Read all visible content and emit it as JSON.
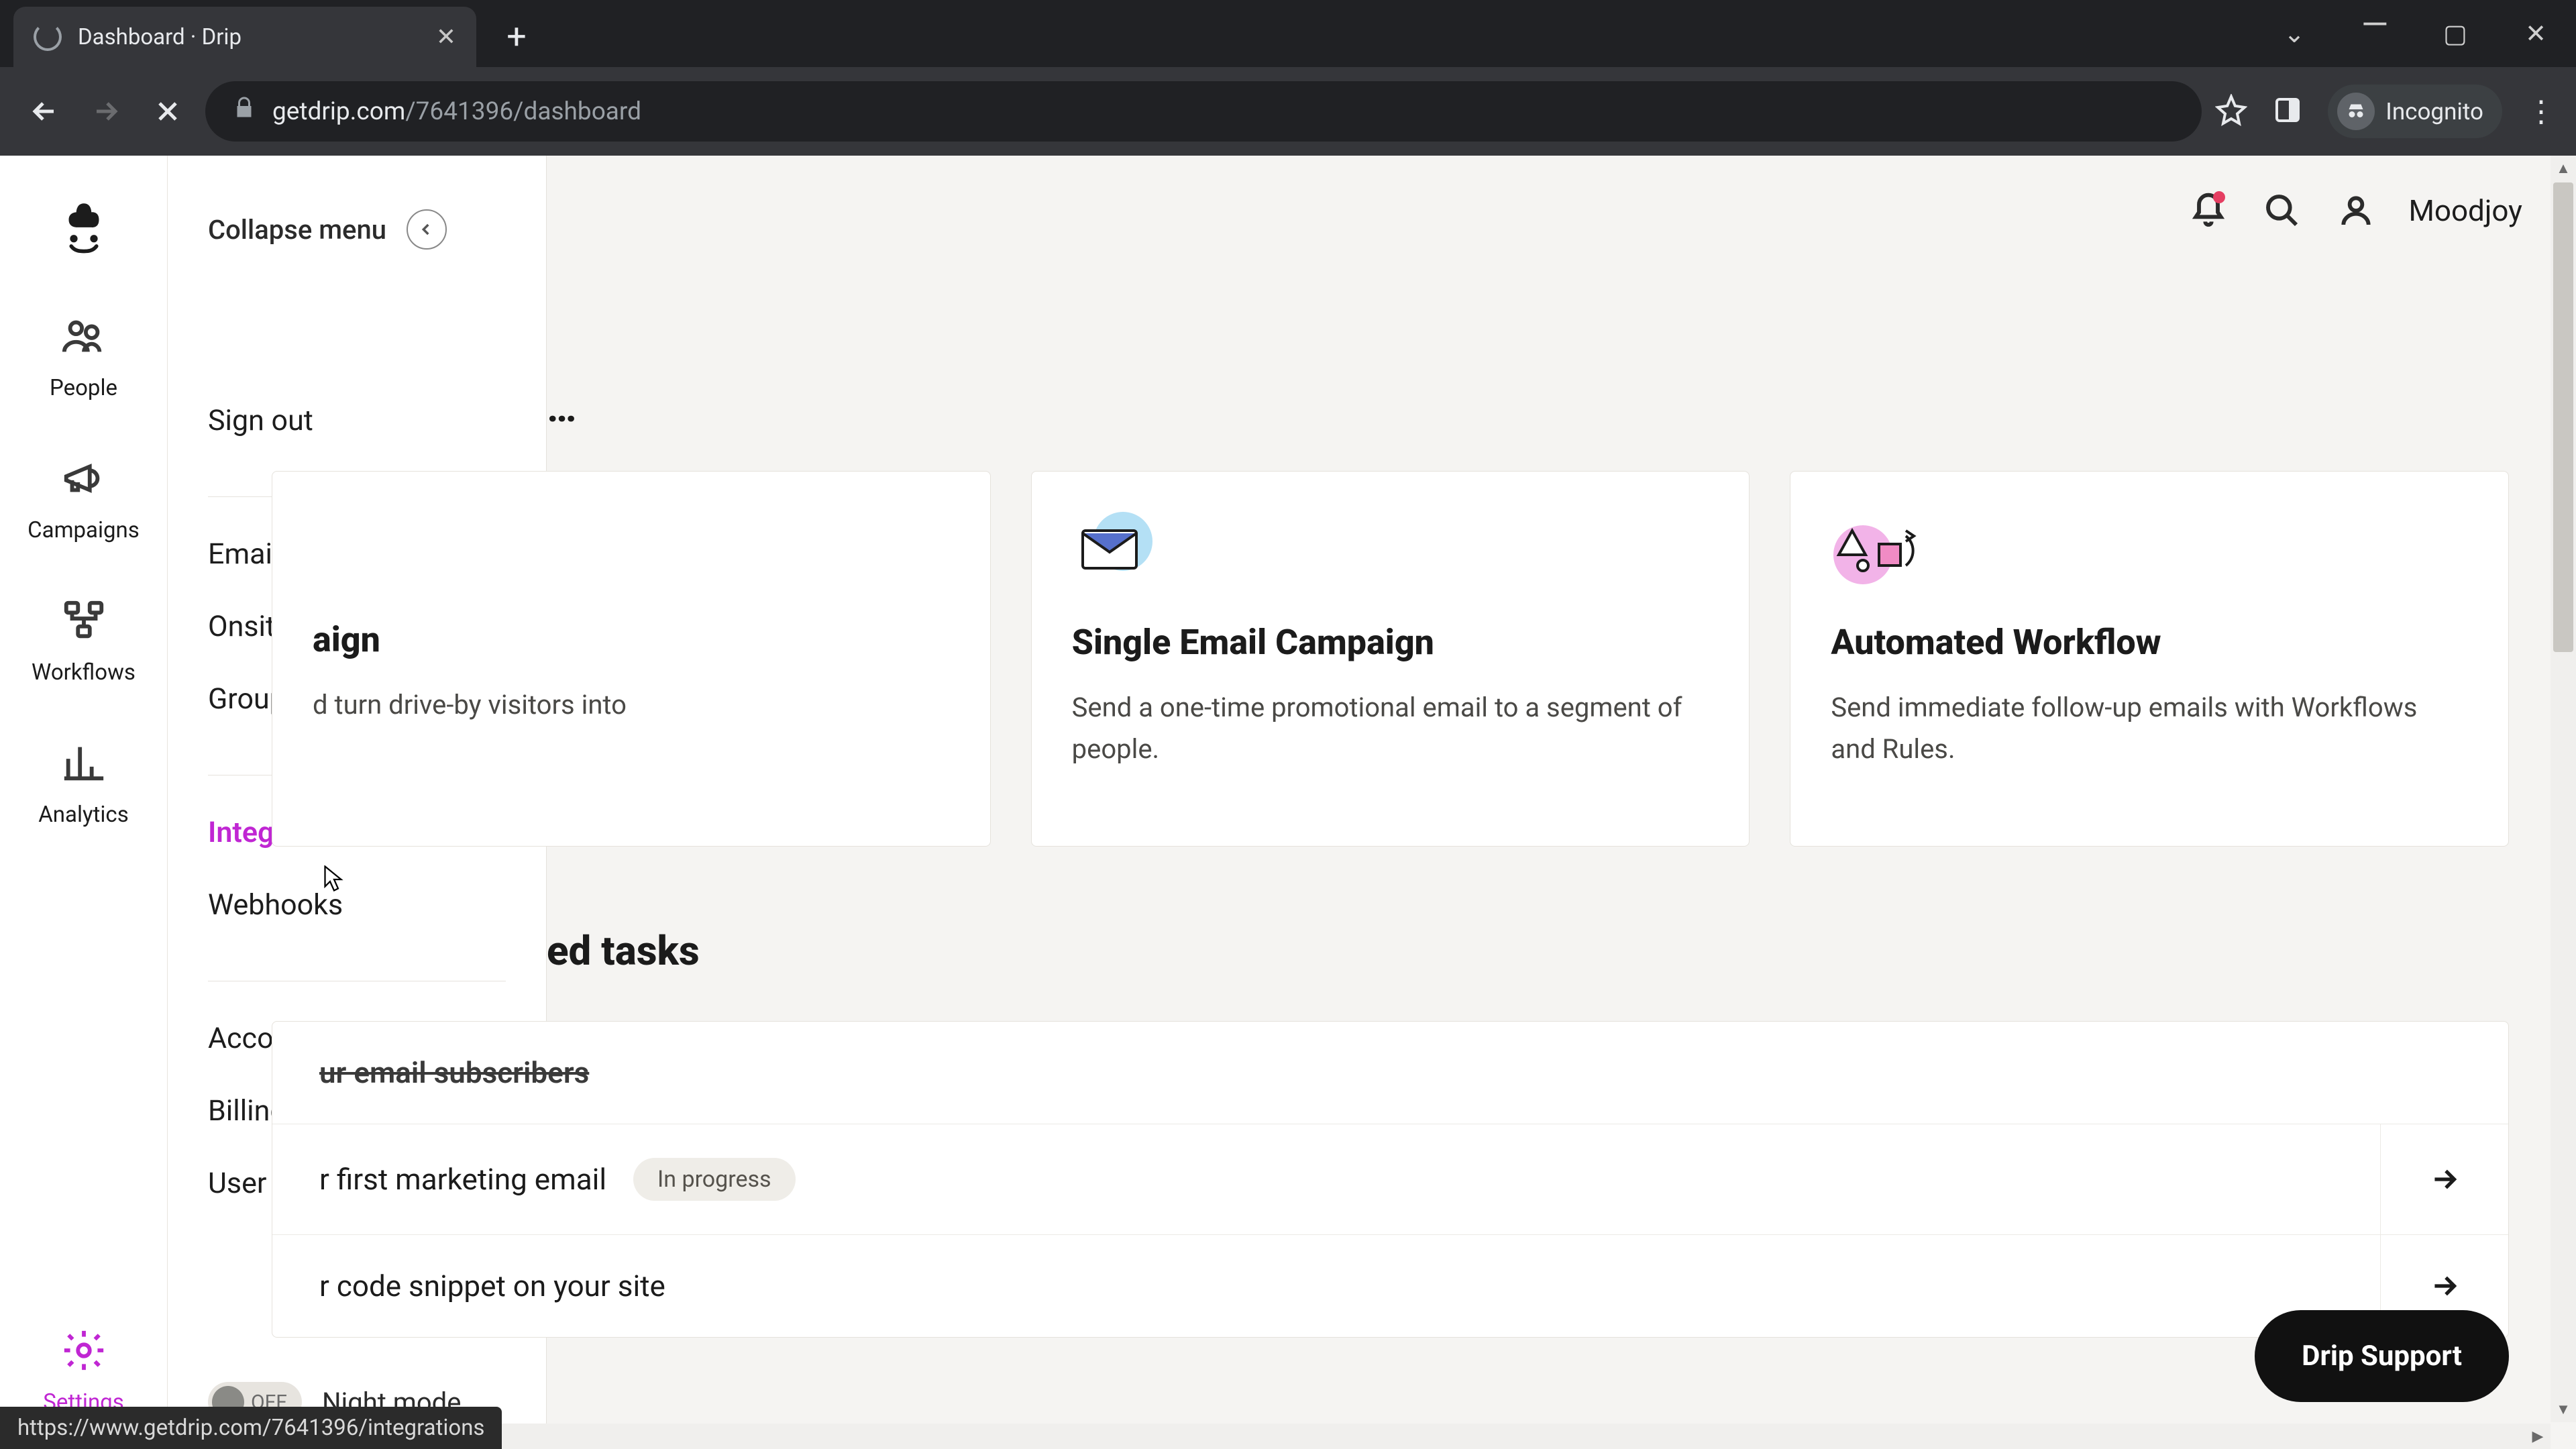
{
  "browser": {
    "tab_title": "Dashboard · Drip",
    "url_domain": "getdrip.com",
    "url_path": "/7641396/dashboard",
    "incognito_label": "Incognito",
    "status_url": "https://www.getdrip.com/7641396/integrations"
  },
  "rail": {
    "items": [
      {
        "label": "People"
      },
      {
        "label": "Campaigns"
      },
      {
        "label": "Workflows"
      },
      {
        "label": "Analytics"
      }
    ],
    "settings_label": "Settings"
  },
  "flyout": {
    "collapse_label": "Collapse menu",
    "links": {
      "sign_out": "Sign out",
      "email_setup": "Email setup",
      "onsite_setup": "Onsite setup",
      "groups": "Groups",
      "integrations": "Integrations",
      "webhooks": "Webhooks",
      "account": "Account",
      "billing": "Billing",
      "user_settings": "User settings"
    },
    "night_mode_label": "Night mode",
    "toggle_state": "OFF"
  },
  "header": {
    "username": "Moodjoy"
  },
  "main": {
    "heading_fragment": "…",
    "cards": [
      {
        "title_fragment": "aign",
        "desc_fragment": "d turn drive-by visitors into"
      },
      {
        "title": "Single Email Campaign",
        "desc": "Send a one-time promotional email to a segment of people."
      },
      {
        "title": "Automated Workflow",
        "desc": "Send immediate follow-up emails with Workflows and Rules."
      }
    ],
    "tasks_heading_fragment": "ed tasks",
    "tasks": [
      {
        "label_fragment": "ur email subscribers",
        "done": true
      },
      {
        "label_fragment": "r first marketing email",
        "badge": "In progress"
      },
      {
        "label_fragment": "r code snippet on your site"
      }
    ]
  },
  "support_label": "Drip Support"
}
